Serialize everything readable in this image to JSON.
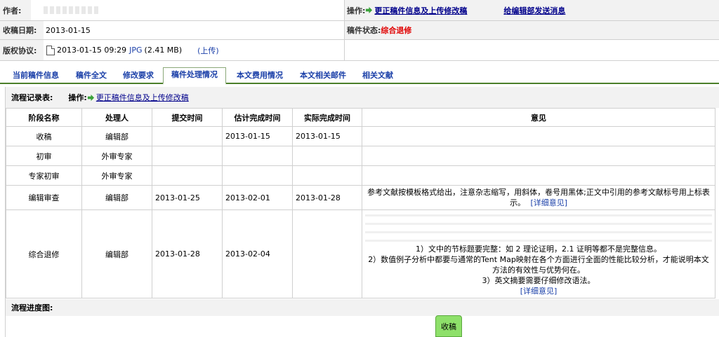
{
  "info": {
    "author_label": "作者:",
    "author_value": "",
    "operation_label": "操作:",
    "correct_link": "更正稿件信息及上传修改稿",
    "message_link": "给编辑部发送消息",
    "received_label": "收稿日期:",
    "received_value": "2013-01-15",
    "status_label": "稿件状态:",
    "status_value": "综合退修",
    "copyright_label": "版权协议:",
    "file_date": "2013-01-15 09:29",
    "file_type": "JPG",
    "file_size": "(2.41 MB)",
    "upload_link": "(上传)"
  },
  "tabs": [
    {
      "label": "当前稿件信息",
      "active": false
    },
    {
      "label": "稿件全文",
      "active": false
    },
    {
      "label": "修改要求",
      "active": false
    },
    {
      "label": "稿件处理情况",
      "active": true
    },
    {
      "label": "本文费用情况",
      "active": false
    },
    {
      "label": "本文相关邮件",
      "active": false
    },
    {
      "label": "相关文献",
      "active": false
    }
  ],
  "panel": {
    "records_label": "流程记录表:",
    "operation_label": "操作:",
    "correct_link": "更正稿件信息及上传修改稿",
    "progress_label": "流程进度图:",
    "progress_node": "收稿"
  },
  "flow_table": {
    "headers": [
      "阶段名称",
      "处理人",
      "提交时间",
      "估计完成时间",
      "实际完成时间",
      "意见"
    ],
    "rows": [
      {
        "stage": "收稿",
        "handler": "编辑部",
        "submitted": "",
        "estimated": "2013-01-15",
        "actual": "2013-01-15",
        "opinion": ""
      },
      {
        "stage": "初审",
        "handler": "外审专家",
        "submitted": "",
        "estimated": "",
        "actual": "",
        "opinion": ""
      },
      {
        "stage": "专家初审",
        "handler": "外审专家",
        "submitted": "",
        "estimated": "",
        "actual": "",
        "opinion": ""
      },
      {
        "stage": "编辑审查",
        "handler": "编辑部",
        "submitted": "2013-01-25",
        "estimated": "2013-02-01",
        "actual": "2013-01-28",
        "opinion": "参考文献按模板格式给出，注意杂志缩写，用斜体，卷号用黑体;正文中引用的参考文献标号用上标表示。",
        "detail": "[详细意见]"
      },
      {
        "stage": "综合退修",
        "handler": "编辑部",
        "submitted": "2013-01-28",
        "estimated": "2013-02-04",
        "actual": "",
        "opinion_lines": [
          "1）文中的节标题要完整：如 2 理论证明，2.1 证明等都不是完整信息。",
          "2）数值例子分析中都要与通常的Tent Map映射在各个方面进行全面的性能比较分析，才能说明本文方法的有效性与优势何在。",
          "3）英文摘要需要仔细修改语法。"
        ],
        "detail": "[详细意见]"
      }
    ]
  },
  "colors": {
    "tab_border": "#4c7f2a",
    "link": "#00008b",
    "status": "#e00000",
    "node": "#8ee06a"
  }
}
